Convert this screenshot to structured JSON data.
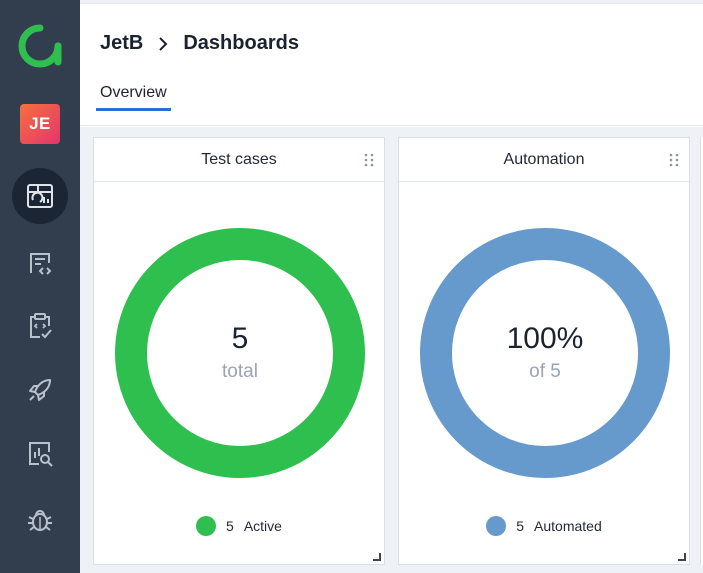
{
  "colors": {
    "sidebar_bg": "#323d4e",
    "brand_green": "#2fbf4f",
    "active_green": "#2fbf4f",
    "automated_blue": "#6699cc",
    "tab_underline": "#2a6fd1",
    "avatar_gradient_start": "#f6703d",
    "avatar_gradient_end": "#e3356e"
  },
  "sidebar": {
    "logo_icon": "allure-logo-icon",
    "avatar_initials": "JE",
    "items": [
      {
        "name": "dashboards",
        "icon": "dashboard-icon",
        "active": true
      },
      {
        "name": "test-cases",
        "icon": "code-document-icon",
        "active": false
      },
      {
        "name": "test-plans",
        "icon": "clipboard-check-icon",
        "active": false
      },
      {
        "name": "launches",
        "icon": "rocket-icon",
        "active": false
      },
      {
        "name": "analytics",
        "icon": "chart-search-icon",
        "active": false
      },
      {
        "name": "defects",
        "icon": "bug-icon",
        "active": false
      }
    ]
  },
  "header": {
    "breadcrumb": {
      "project": "JetB",
      "separator_icon": "chevron-right-icon",
      "page": "Dashboards"
    },
    "tabs": [
      {
        "label": "Overview",
        "active": true
      }
    ]
  },
  "widgets": [
    {
      "title": "Test cases",
      "value": "5",
      "subtitle": "total",
      "legend": [
        {
          "count": "5",
          "label": "Active",
          "color": "#2fbf4f"
        }
      ],
      "fraction": 1.0
    },
    {
      "title": "Automation",
      "value": "100%",
      "subtitle": "of 5",
      "legend": [
        {
          "count": "5",
          "label": "Automated",
          "color": "#6699cc"
        }
      ],
      "fraction": 1.0
    }
  ]
}
